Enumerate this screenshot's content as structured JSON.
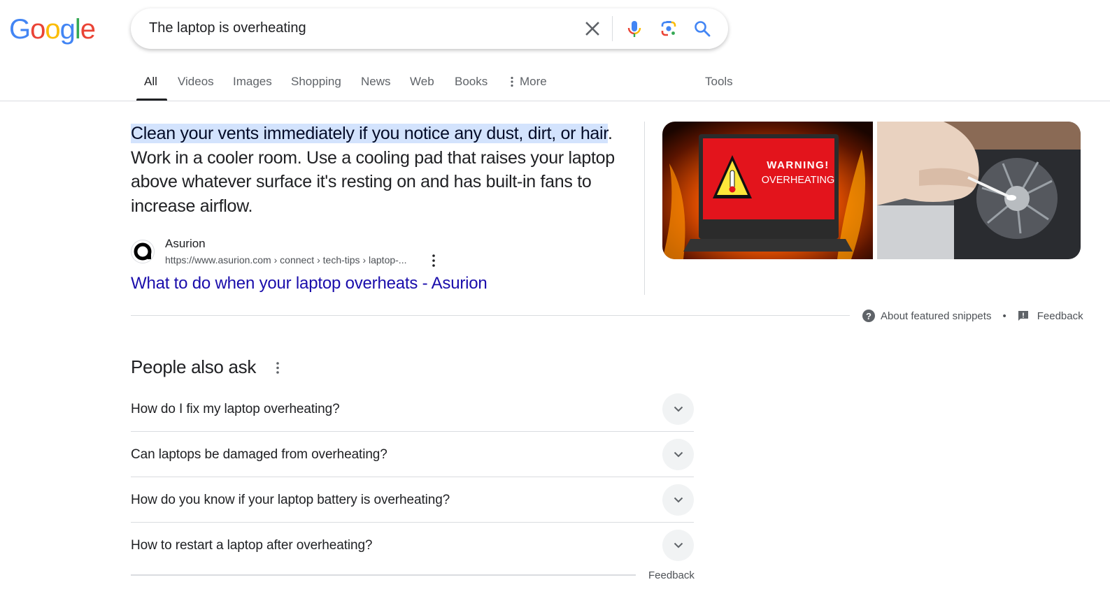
{
  "logo": {
    "letters": [
      "G",
      "o",
      "o",
      "g",
      "l",
      "e"
    ],
    "colors": [
      "#4285f4",
      "#ea4335",
      "#fbbc05",
      "#4285f4",
      "#34a853",
      "#ea4335"
    ]
  },
  "search": {
    "query": "The laptop is overheating",
    "icons": [
      "close-icon",
      "microphone-icon",
      "camera-lens-icon",
      "search-icon"
    ]
  },
  "tabs": [
    {
      "label": "All",
      "active": true
    },
    {
      "label": "Videos"
    },
    {
      "label": "Images"
    },
    {
      "label": "Shopping"
    },
    {
      "label": "News"
    },
    {
      "label": "Web"
    },
    {
      "label": "Books"
    },
    {
      "label": "More"
    }
  ],
  "tools_label": "Tools",
  "snippet": {
    "highlight": "Clean your vents immediately if you notice any dust, dirt, or hair",
    "rest": ". Work in a cooler room. Use a cooling pad that raises your laptop above whatever surface it's resting on and has built-in fans to increase airflow.",
    "source_name": "Asurion",
    "source_url": "https://www.asurion.com › connect › tech-tips › laptop-...",
    "title": "What to do when your laptop overheats - Asurion",
    "image1_text": [
      "WARNING!",
      "OVERHEATING"
    ]
  },
  "about_snippets_label": "About featured snippets",
  "separator": "•",
  "feedback_label": "Feedback",
  "paa": {
    "title": "People also ask",
    "questions": [
      "How do I fix my laptop overheating?",
      "Can laptops be damaged from overheating?",
      "How do you know if your laptop battery is overheating?",
      "How to restart a laptop after overheating?"
    ],
    "feedback_label": "Feedback"
  },
  "colors": {
    "link": "#1a0dab",
    "highlight": "#d3e3fd",
    "text": "#202124",
    "secondary": "#5f6368"
  }
}
